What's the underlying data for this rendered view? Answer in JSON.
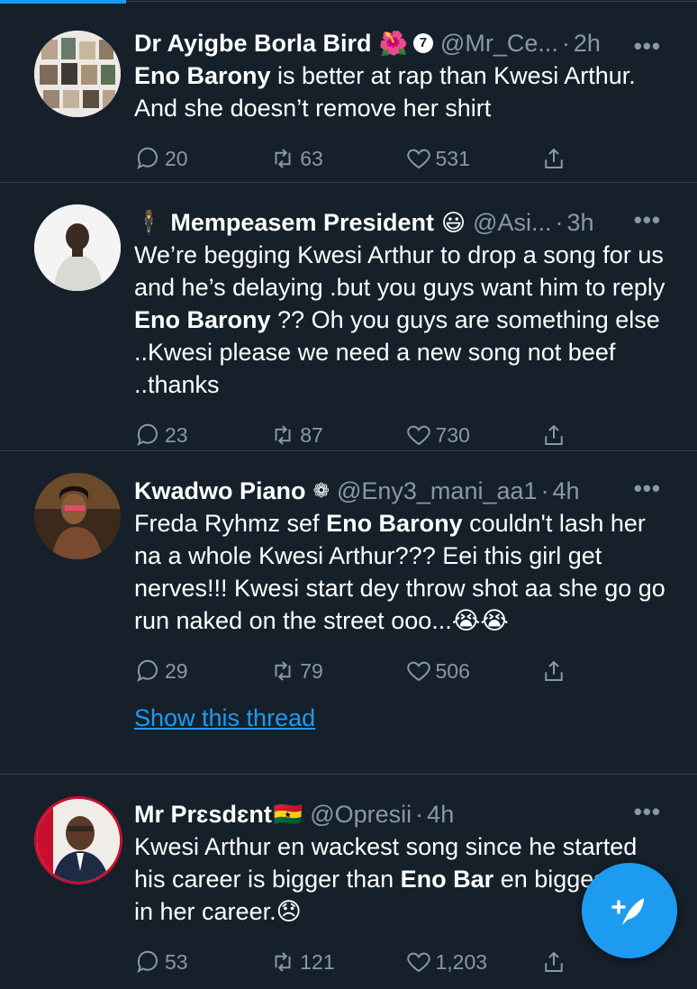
{
  "colors": {
    "background": "#15202b",
    "accent": "#1d9bf0",
    "muted": "#8899a6",
    "divider": "#38444d"
  },
  "tweets": [
    {
      "name": "Dr Ayigbe Borla Bird",
      "emoji": "🌺",
      "badge": "7",
      "handle": "@Mr_Ce...",
      "time": "2h",
      "text_parts": [
        {
          "t": "Eno Barony",
          "b": true
        },
        {
          "t": " is better at rap than Kwesi Arthur. And she doesn’t remove her shirt",
          "b": false
        }
      ],
      "replies": "20",
      "retweets": "63",
      "likes": "531"
    },
    {
      "prefix_emoji": "🕴",
      "name": "Mempeasem President",
      "emoji": "😃",
      "handle": "@Asi...",
      "time": "3h",
      "text_parts": [
        {
          "t": "We’re begging Kwesi Arthur to drop a song for us and he’s delaying .but you guys want him to reply ",
          "b": false
        },
        {
          "t": "Eno Barony",
          "b": true
        },
        {
          "t": " ?? Oh you guys are something else ..Kwesi please we need a new song not beef ..thanks",
          "b": false
        }
      ],
      "replies": "23",
      "retweets": "87",
      "likes": "730"
    },
    {
      "name": "Kwadwo Piano",
      "emoji": "❁",
      "handle": "@Eny3_mani_aa1",
      "time": "4h",
      "text_parts": [
        {
          "t": "Freda Ryhmz sef ",
          "b": false
        },
        {
          "t": "Eno Barony",
          "b": true
        },
        {
          "t": " couldn't lash her na a whole Kwesi Arthur??? Eei this girl get nerves!!! Kwesi start dey throw shot aa she go go run naked on the street ooo...😭😭",
          "b": false
        }
      ],
      "replies": "29",
      "retweets": "79",
      "likes": "506",
      "thread_link": "Show this thread"
    },
    {
      "name": "Mr Prɛsdɛnt",
      "emoji": "🇬🇭",
      "handle": "@Opresii",
      "time": "4h",
      "text_parts": [
        {
          "t": "Kwesi Arthur en wackest song since he started his career is bigger than ",
          "b": false
        },
        {
          "t": "Eno Bar",
          "b": true
        },
        {
          "t": " en biggest hit in her career.😞",
          "b": false
        }
      ],
      "replies": "53",
      "retweets": "121",
      "likes": "1,203"
    }
  ]
}
